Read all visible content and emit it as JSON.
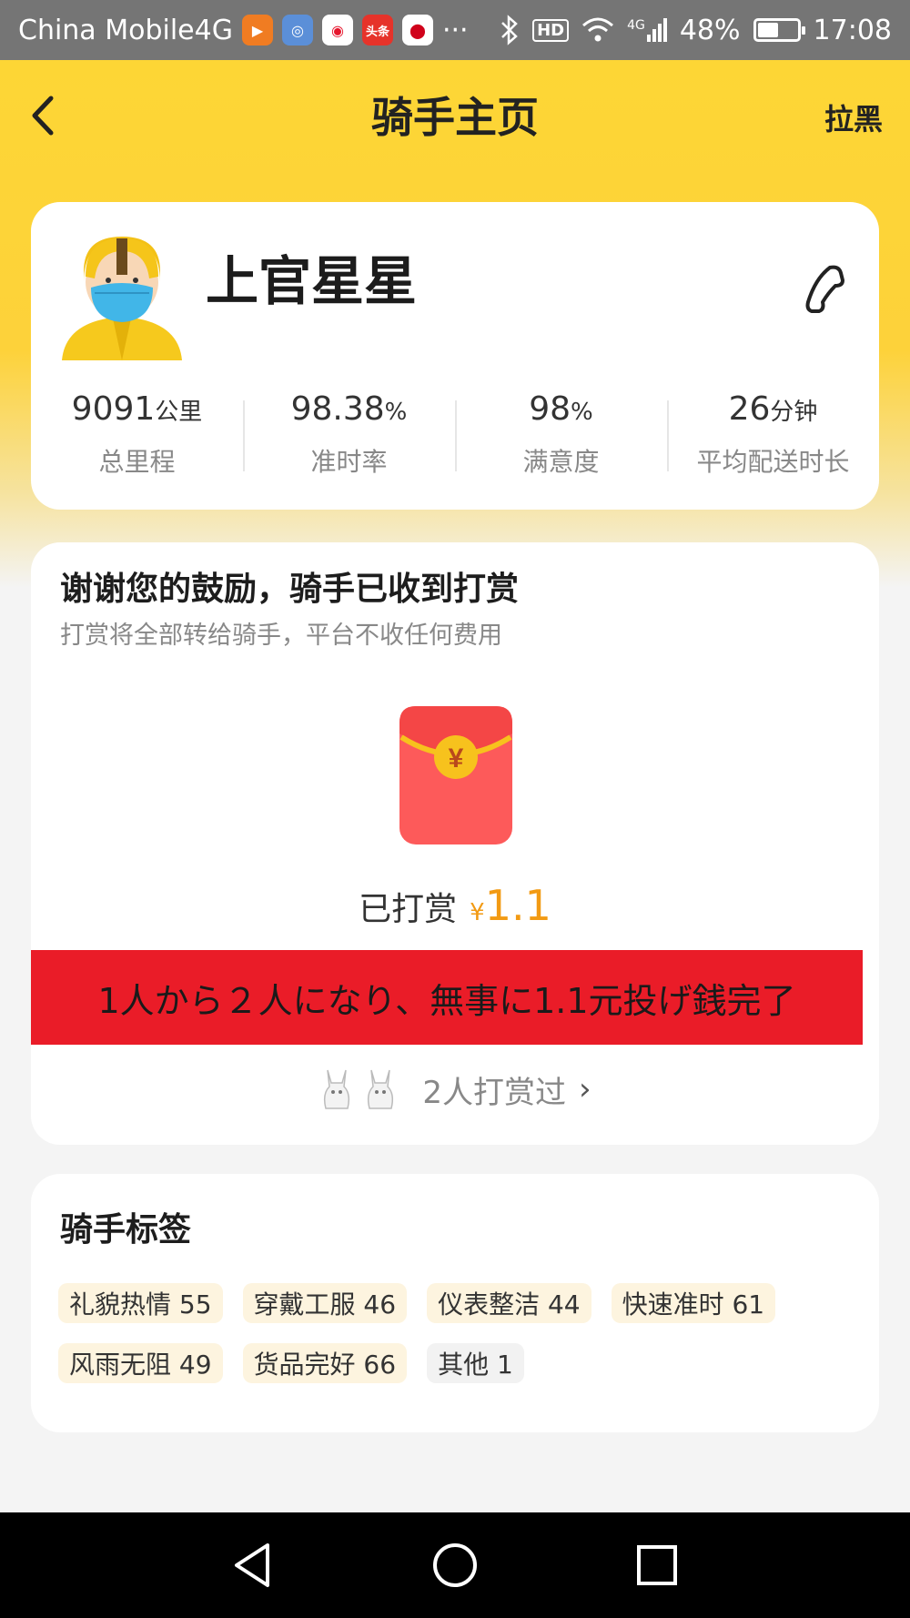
{
  "status_bar": {
    "carrier": "China Mobile4G",
    "more": "···",
    "hd": "HD",
    "network": "4G",
    "battery": "48%",
    "battery_level": 0.48,
    "time": "17:08"
  },
  "header": {
    "title": "骑手主页",
    "block_label": "拉黑"
  },
  "rider": {
    "name": "上官星星",
    "stats": [
      {
        "value": "9091",
        "unit": "公里",
        "label": "总里程"
      },
      {
        "value": "98.38",
        "unit": "%",
        "label": "准时率"
      },
      {
        "value": "98",
        "unit": "%",
        "label": "满意度"
      },
      {
        "value": "26",
        "unit": "分钟",
        "label": "平均配送时长"
      }
    ]
  },
  "reward": {
    "title": "谢谢您的鼓励，骑手已收到打赏",
    "subtitle": "打赏将全部转给骑手，平台不收任何费用",
    "amount_prefix": "已打赏",
    "currency": "¥",
    "amount": "1.1",
    "banner": "1人から２人になり、無事に1.1元投げ銭完了",
    "tippers_text": "2人打赏过",
    "chevron": "›"
  },
  "tags_section": {
    "title": "骑手标签",
    "tags": [
      "礼貌热情 55",
      "穿戴工服 46",
      "仪表整洁 44",
      "快速准时 61",
      "风雨无阻 49",
      "货品完好 66",
      "其他 1"
    ]
  },
  "colors": {
    "brand_yellow": "#fdd635",
    "reward_orange": "#f29a13",
    "banner_red": "#ea1c28"
  }
}
